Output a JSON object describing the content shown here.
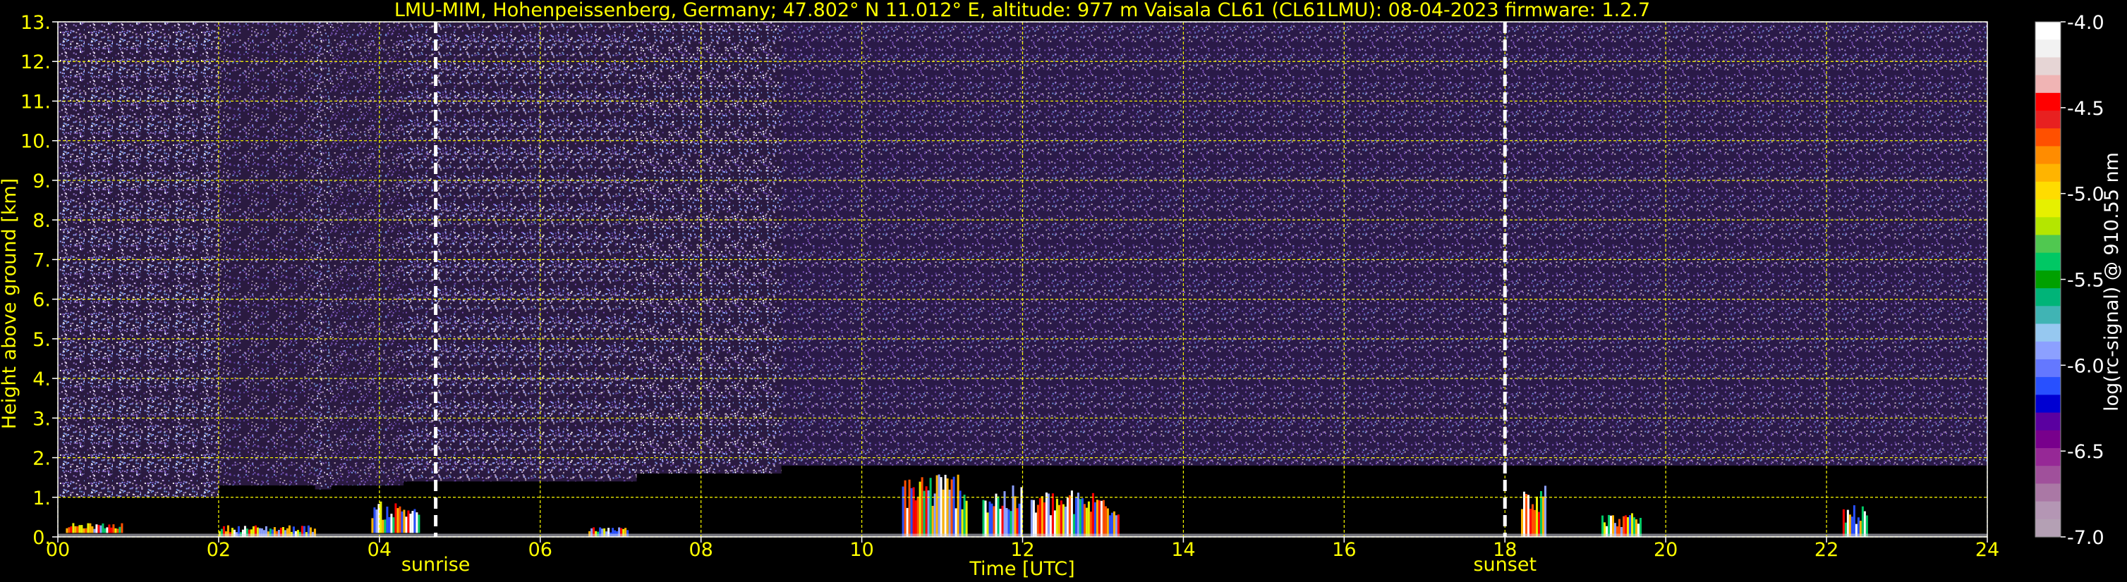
{
  "chart_data": {
    "type": "heatmap",
    "title": "LMU-MIM, Hohenpeissenberg, Germany; 47.802° N 11.012° E, altitude: 977 m    Vaisala CL61 (CL61LMU): 08-04-2023    firmware: 1.2.7",
    "xlabel": "Time [UTC]",
    "ylabel": "Height above ground [km]",
    "xlim": [
      0,
      24
    ],
    "ylim": [
      0,
      13
    ],
    "x_ticks": [
      "00",
      "02",
      "04",
      "06",
      "08",
      "10",
      "12",
      "14",
      "16",
      "18",
      "20",
      "22",
      "24"
    ],
    "y_ticks": [
      "0.",
      "1.",
      "2.",
      "3.",
      "4.",
      "5.",
      "6.",
      "7.",
      "8.",
      "9.",
      "10.",
      "11.",
      "12.",
      "13."
    ],
    "grid": true,
    "events": [
      {
        "label": "sunrise",
        "time": 4.7
      },
      {
        "label": "sunset",
        "time": 18.0
      }
    ],
    "colorbar": {
      "label": "log(rc-signal) @ 910.55 nm",
      "range": [
        -7.0,
        -4.0
      ],
      "ticks": [
        "-4.0",
        "-4.5",
        "-5.0",
        "-5.5",
        "-6.0",
        "-6.5",
        "-7.0"
      ],
      "tick_values": [
        -4.0,
        -4.5,
        -5.0,
        -5.5,
        -6.0,
        -6.5,
        -7.0
      ],
      "colors": [
        "#ffffff",
        "#f2f2f2",
        "#e6d5d5",
        "#f0b4b4",
        "#ff0000",
        "#e82020",
        "#ff5000",
        "#ff8c00",
        "#ffb400",
        "#ffdc00",
        "#e6f000",
        "#b4e600",
        "#50c850",
        "#00c864",
        "#00a000",
        "#00b478",
        "#40b4b4",
        "#96c8f0",
        "#8ca0ff",
        "#6478ff",
        "#2850ff",
        "#0000d2",
        "#5a00a0",
        "#78008c",
        "#962896",
        "#a0509b",
        "#aa78a5",
        "#b496b4",
        "#b4a0b4"
      ]
    },
    "signal_segments": [
      {
        "x": [
          0,
          2.0
        ],
        "noise_floor_km": 1.0,
        "level": 0.55
      },
      {
        "x": [
          2.0,
          3.2
        ],
        "noise_floor_km": 1.3,
        "level": 0.25
      },
      {
        "x": [
          3.2,
          3.4
        ],
        "noise_floor_km": 1.2,
        "level": 0.5
      },
      {
        "x": [
          3.4,
          4.3
        ],
        "noise_floor_km": 1.3,
        "level": 0.28
      },
      {
        "x": [
          4.3,
          7.2
        ],
        "noise_floor_km": 1.4,
        "level": 0.5
      },
      {
        "x": [
          7.2,
          9.0
        ],
        "noise_floor_km": 1.6,
        "level": 0.5
      },
      {
        "x": [
          9.0,
          24.0
        ],
        "noise_floor_km": 1.8,
        "level": 0.2
      }
    ],
    "cloud_layers": [
      {
        "x": [
          0.1,
          0.8
        ],
        "bottom_km": 0.1,
        "top_km": 0.35
      },
      {
        "x": [
          2.0,
          3.2
        ],
        "bottom_km": 0.0,
        "top_km": 0.3
      },
      {
        "x": [
          3.9,
          4.5
        ],
        "bottom_km": 0.1,
        "top_km": 0.9
      },
      {
        "x": [
          6.6,
          7.1
        ],
        "bottom_km": 0.0,
        "top_km": 0.25
      },
      {
        "x": [
          10.5,
          11.3
        ],
        "bottom_km": 0.0,
        "top_km": 1.7
      },
      {
        "x": [
          11.5,
          12.0
        ],
        "bottom_km": 0.0,
        "top_km": 1.3
      },
      {
        "x": [
          12.1,
          13.2
        ],
        "bottom_km": 0.0,
        "top_km": 1.2
      },
      {
        "x": [
          18.2,
          18.5
        ],
        "bottom_km": 0.0,
        "top_km": 1.5
      },
      {
        "x": [
          19.2,
          19.7
        ],
        "bottom_km": 0.0,
        "top_km": 0.6
      },
      {
        "x": [
          22.2,
          22.5
        ],
        "bottom_km": 0.0,
        "top_km": 0.8
      }
    ]
  }
}
